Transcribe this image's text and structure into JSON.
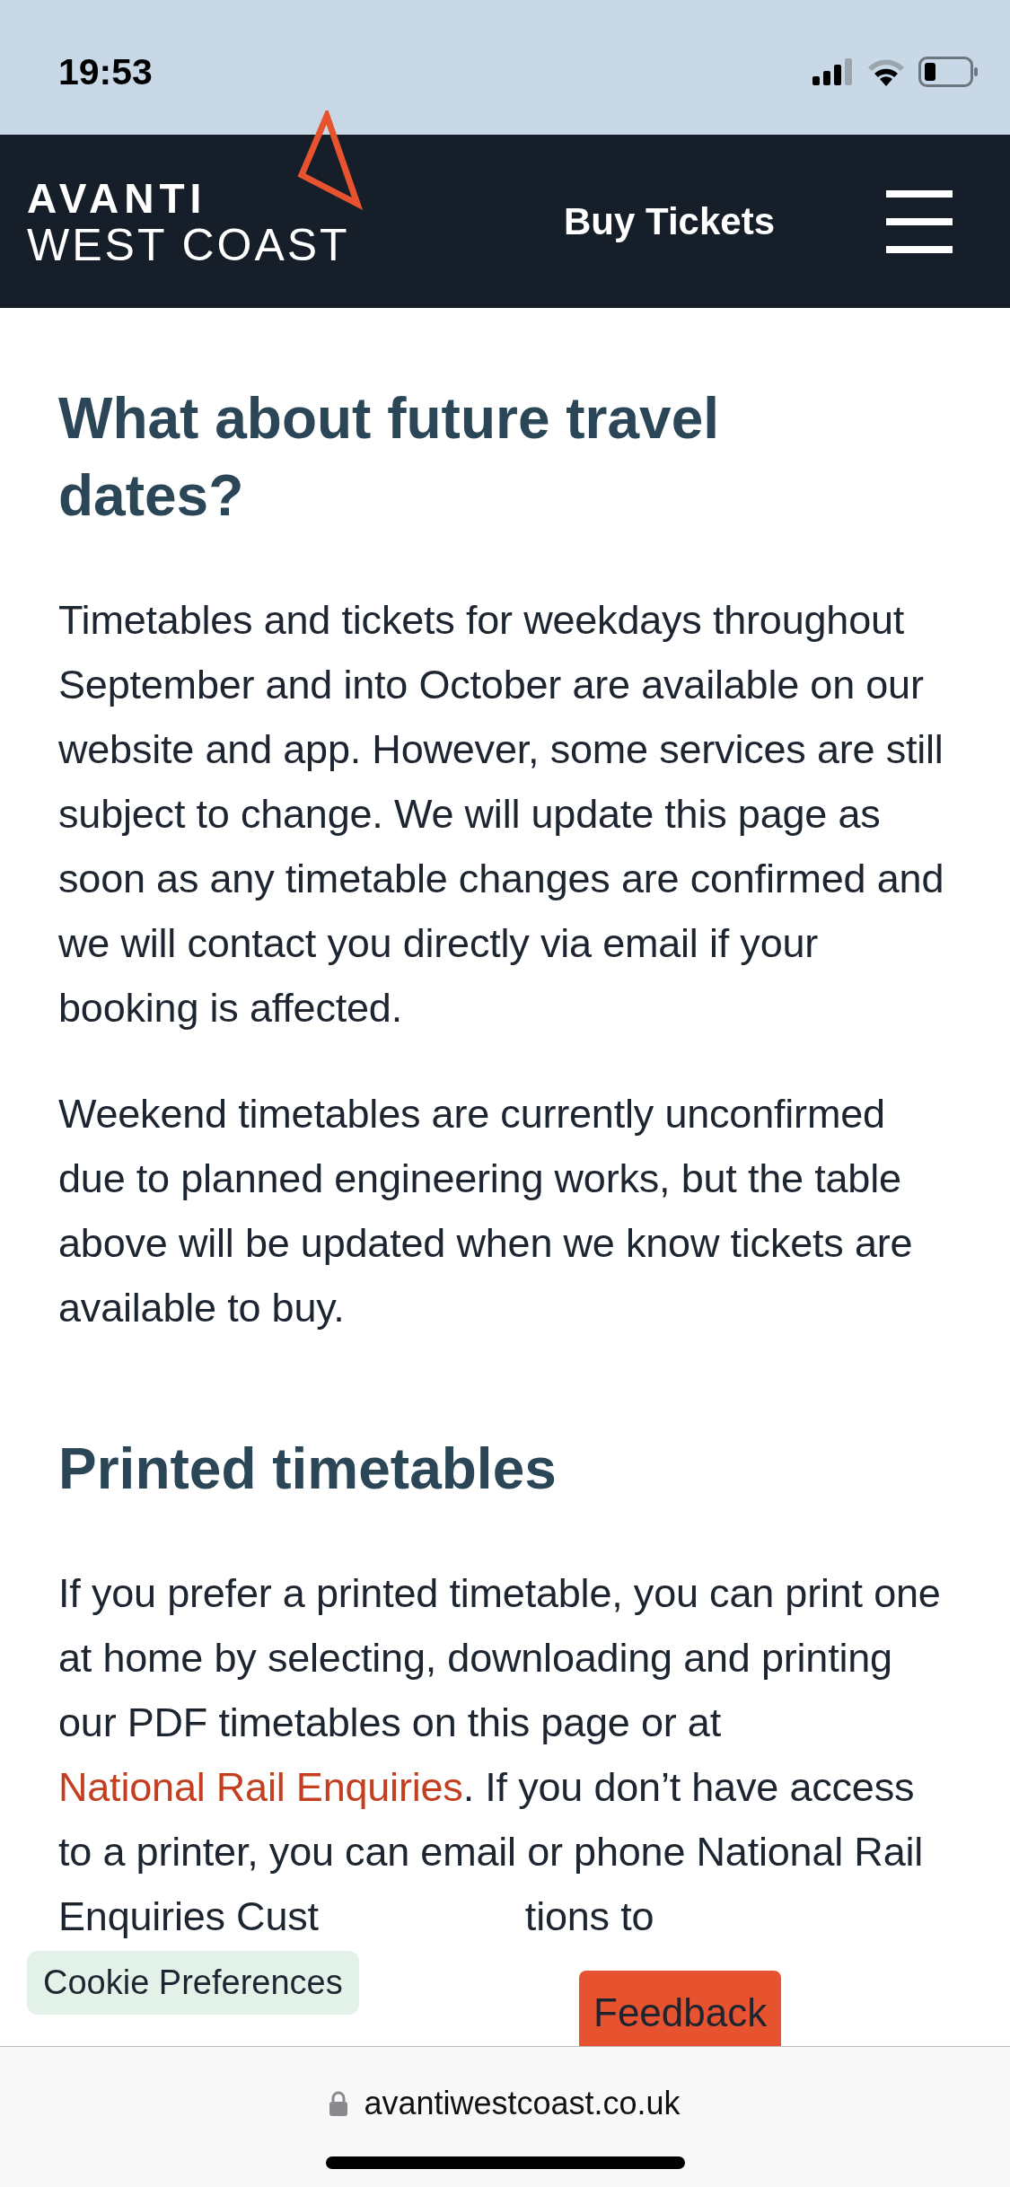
{
  "status_bar": {
    "time": "19:53"
  },
  "header": {
    "logo_top": "AVANTI",
    "logo_bottom": "WEST COAST",
    "buy_tickets": "Buy Tickets"
  },
  "sections": [
    {
      "heading": "What about future travel dates?",
      "paragraphs": [
        {
          "text": "Timetables and tickets for weekdays throughout September and into October are available on our website and app. However, some services are still subject to change. We will update this page as soon as any timetable changes are confirmed and we will contact you directly via email if your booking is affected."
        },
        {
          "text": "Weekend timetables are currently unconfirmed due to planned engineering works, but the table above will be updated when we know tickets are available to buy."
        }
      ]
    },
    {
      "heading": "Printed timetables",
      "paragraphs": [
        {
          "text": "If you prefer a printed timetable, you can print one at home by selecting, downloading and printing our PDF timetables on this page or at ",
          "link": "National Rail Enquiries",
          "after": ". If you don’t have access to a printer, you can email or phone National Rail Enquiries Cust",
          "tail": "tions to"
        }
      ]
    }
  ],
  "cookie_button": "Cookie Preferences",
  "feedback_button": "Feedback",
  "address_bar": {
    "url": "avantiwestcoast.co.uk"
  }
}
